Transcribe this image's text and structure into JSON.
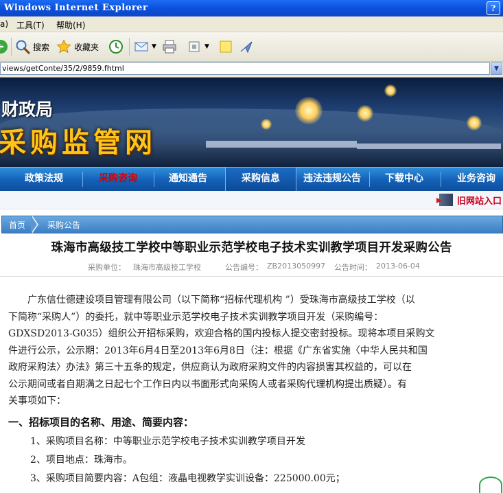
{
  "window": {
    "title": "Windows Internet Explorer",
    "help_label": "?"
  },
  "menu": {
    "left_item": "a)",
    "tools": "工具(T)",
    "help": "帮助(H)"
  },
  "toolbar": {
    "search": "搜索",
    "favorites": "收藏夹"
  },
  "address": {
    "url": "views/getConte/35/2/9859.fhtml"
  },
  "banner": {
    "org": "财政局",
    "site": "采购监管网"
  },
  "nav": {
    "items": [
      {
        "label": "政策法规"
      },
      {
        "label": "采购咨询"
      },
      {
        "label": "通知通告"
      },
      {
        "label": "采购信息"
      },
      {
        "label": "违法违规公告"
      },
      {
        "label": "下载中心"
      },
      {
        "label": "业务咨询"
      }
    ],
    "old_site": "旧网站入口"
  },
  "breadcrumb": {
    "home": "首页",
    "current": "采购公告"
  },
  "article": {
    "title": "珠海市高级技工学校中等职业示范学校电子技术实训教学项目开发采购公告",
    "meta": {
      "unit_label": "采购单位：",
      "unit_value": "珠海市高级技工学校",
      "code_label": "公告编号：",
      "code_value": "ZB2013050997",
      "time_label": "公告时间：",
      "time_value": "2013-06-04"
    },
    "body_lines": [
      "　　广东信仕德建设项目管理有限公司（以下简称“招标代理机构 ”）受珠海市高级技工学校（以",
      "下简称“采购人”）的委托，就中等职业示范学校电子技术实训教学项目开发（采购编号：",
      "GDXSD2013-G035）组织公开招标采购，欢迎合格的国内投标人提交密封投标。现将本项目采购文",
      "件进行公示，公示期：2013年6月4日至2013年6月8日（注：根据《广东省实施〈中华人民共和国",
      "政府采购法〉办法》第三十五条的规定，供应商认为政府采购文件的内容损害其权益的，可以在",
      "公示期间或者自期满之日起七个工作日内以书面形式向采购人或者采购代理机构提出质疑）。有",
      "关事项如下："
    ],
    "section1_title": "一、招标项目的名称、用途、简要内容：",
    "section1_items": [
      "1、采购项目名称：中等职业示范学校电子技术实训教学项目开发",
      "2、项目地点：珠海市。",
      "3、采购项目简要内容：A包组：液晶电视教学实训设备：225000.00元；"
    ]
  }
}
